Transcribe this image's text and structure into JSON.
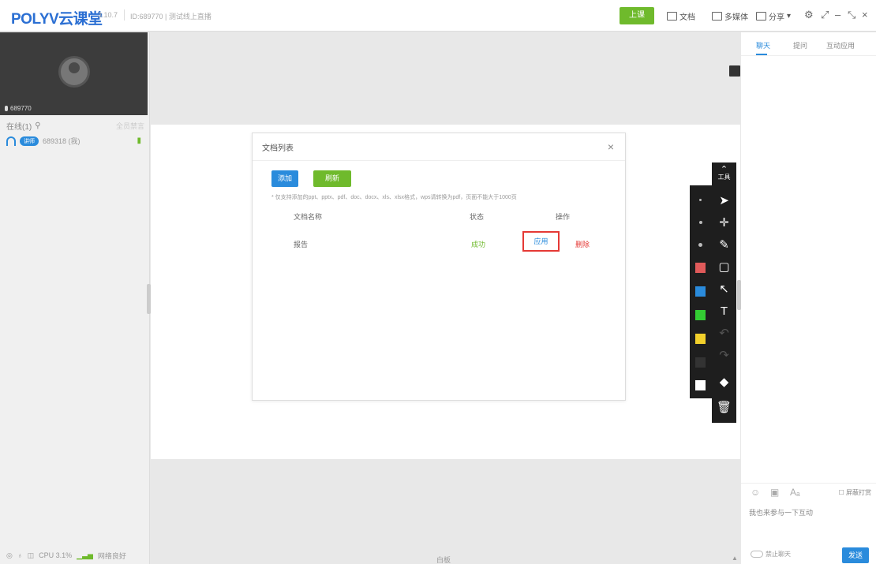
{
  "app": {
    "logo_en": "POLYV",
    "logo_cn": "云课堂",
    "version": "3.10.7",
    "session": "ID:689770 | 测试线上直播"
  },
  "titlebar": {
    "class_button": "上课",
    "docs": "文档",
    "multimedia": "多媒体",
    "share": "分享",
    "share_arrow": "▾",
    "settings_icon": "⚙",
    "restore": "⤢",
    "minimize": "–",
    "expand": "⤡",
    "close": "×"
  },
  "left": {
    "video_user": "689770",
    "online_label": "在线(1)",
    "online_right": "全员禁言",
    "user_badge": "讲师",
    "user_name": "689318 (我)",
    "status_cpu": "CPU 3.1%",
    "status_net": "网络良好"
  },
  "main": {
    "bottom_label": "白板"
  },
  "dialog": {
    "title": "文档列表",
    "add_button": "添加",
    "refresh_button": "刷新",
    "note": "* 仅支持添加的ppt、pptx、pdf、doc、docx、xls、xlsx格式，wps请转换为pdf，页面不能大于1000页",
    "col_name": "文档名称",
    "col_status": "状态",
    "col_action": "操作",
    "row": {
      "name": "报告",
      "status": "成功",
      "apply": "应用",
      "delete": "删除"
    }
  },
  "toolbar": {
    "toggle_label": "工具",
    "palette_colors": [
      "#e05a5a",
      "#2a8bdc",
      "#33cc33",
      "#f2d02b",
      "#333333",
      "#ffffff"
    ]
  },
  "right": {
    "tab_chat": "聊天",
    "tab_qa": "提问",
    "tab_interact": "互动应用",
    "only_me": "屏蔽打赏",
    "placeholder": "我也来参与一下互动",
    "ban_chat": "禁止聊天",
    "send": "发送"
  }
}
